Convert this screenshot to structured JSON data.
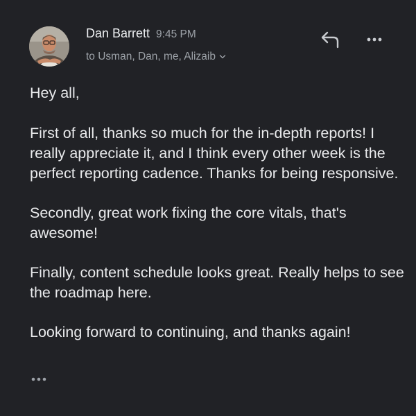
{
  "message": {
    "sender": "Dan Barrett",
    "time": "9:45 PM",
    "recipients": "to Usman, Dan, me, Alizaib"
  },
  "body": {
    "paragraphs": [
      "Hey all,",
      "First of all, thanks so much for the in-depth reports! I really appreciate it, and I think every other week is the perfect reporting cadence. Thanks for being responsive.",
      "Secondly, great work fixing the core vitals, that's awesome!",
      "Finally, content schedule looks great. Really helps to see the roadmap here.",
      "Looking forward to continuing, and thanks again!"
    ]
  },
  "icons": {
    "avatar": "avatar-photo",
    "reply": "reply-icon",
    "more": "more-options-icon",
    "expand": "chevron-down-icon",
    "trimmed": "show-trimmed-content-icon"
  },
  "colors": {
    "background": "#212226",
    "text": "#e9eaec",
    "muted": "#9da2a8"
  }
}
